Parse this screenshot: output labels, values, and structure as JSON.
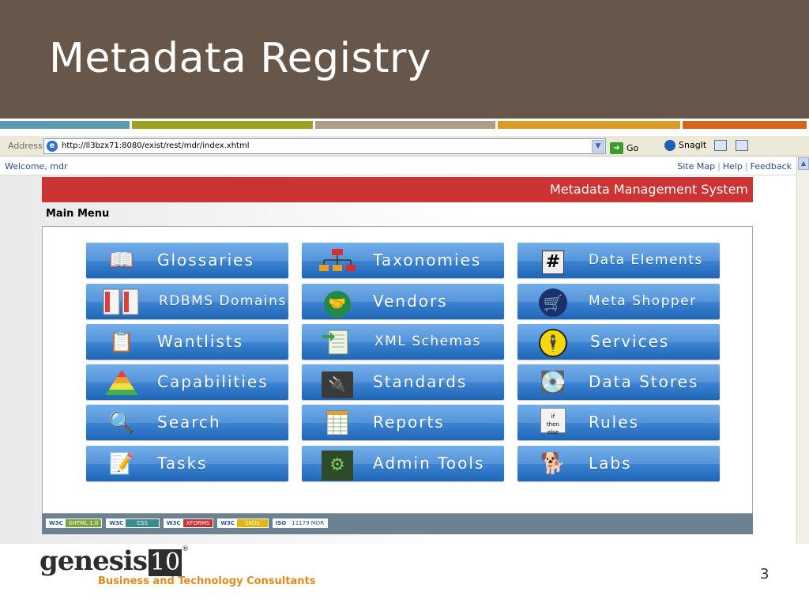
{
  "slide": {
    "title": "Metadata Registry",
    "page_number": "3",
    "strip_colors": [
      "#5b9ab2",
      "#9ba11e",
      "#b19c8a",
      "#dc9b22",
      "#d7621b"
    ]
  },
  "browser": {
    "address_label": "Address",
    "url": "http://ll3bzx71:8080/exist/rest/mdr/index.xhtml",
    "go_label": "Go",
    "snagit_label": "SnagIt"
  },
  "site": {
    "welcome": "Welcome, mdr",
    "links": [
      "Site Map",
      "Help",
      "Feedback"
    ],
    "banner_title": "Metadata Management System",
    "main_menu_label": "Main Menu",
    "tiles": [
      {
        "label": "Glossaries",
        "icon": "book-icon"
      },
      {
        "label": "Taxonomies",
        "icon": "hierarchy-icon"
      },
      {
        "label": "Data Elements",
        "icon": "hash-icon"
      },
      {
        "label": "RDBMS Domains",
        "icon": "database-tables-icon"
      },
      {
        "label": "Vendors",
        "icon": "handshake-icon"
      },
      {
        "label": "Meta Shopper",
        "icon": "shopping-cart-icon"
      },
      {
        "label": "Wantlists",
        "icon": "clipboard-icon"
      },
      {
        "label": "XML Schemas",
        "icon": "schema-document-icon"
      },
      {
        "label": "Services",
        "icon": "service-person-icon"
      },
      {
        "label": "Capabilities",
        "icon": "pyramid-icon"
      },
      {
        "label": "Standards",
        "icon": "power-outlet-icon"
      },
      {
        "label": "Data Stores",
        "icon": "hard-drive-icon"
      },
      {
        "label": "Search",
        "icon": "magnifier-icon"
      },
      {
        "label": "Reports",
        "icon": "spreadsheet-icon"
      },
      {
        "label": "Rules",
        "icon": "if-then-else-icon"
      },
      {
        "label": "Tasks",
        "icon": "notepad-icon"
      },
      {
        "label": "Admin Tools",
        "icon": "gears-icon"
      },
      {
        "label": "Labs",
        "icon": "puppy-icon"
      }
    ],
    "badges": [
      {
        "left": "W3C",
        "right": "XHTML 1.0",
        "color": "#7aa83a"
      },
      {
        "left": "W3C",
        "right": "CSS",
        "color": "#3c8c8c"
      },
      {
        "left": "W3C",
        "right": "XFORMS",
        "color": "#c83232"
      },
      {
        "left": "W3C",
        "right": "SKOS",
        "color": "#e2b70c"
      },
      {
        "left": "ISO",
        "right": "11179 MDR",
        "color": "#6c8290"
      }
    ]
  },
  "logo": {
    "name": "genesis",
    "number": "10",
    "tagline": "Business and Technology Consultants"
  }
}
